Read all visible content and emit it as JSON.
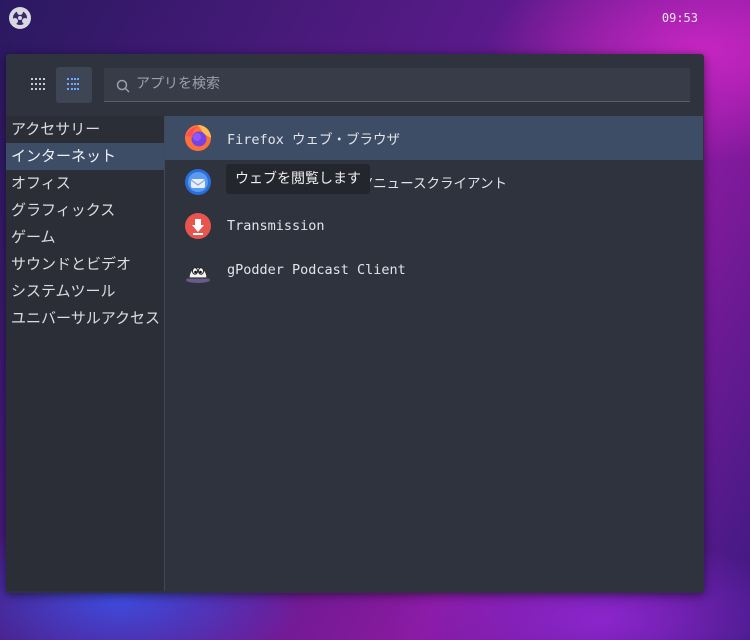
{
  "topbar": {
    "clock": "09:53",
    "distro_icon": "os-logo-icon"
  },
  "menu": {
    "view_buttons": {
      "grid": "grid-view-icon",
      "list": "list-view-icon"
    },
    "search": {
      "placeholder": "アプリを検索",
      "value": ""
    },
    "categories": [
      {
        "label": "アクセサリー",
        "selected": false
      },
      {
        "label": "インターネット",
        "selected": true
      },
      {
        "label": "オフィス",
        "selected": false
      },
      {
        "label": "グラフィックス",
        "selected": false
      },
      {
        "label": "ゲーム",
        "selected": false
      },
      {
        "label": "サウンドとビデオ",
        "selected": false
      },
      {
        "label": "システムツール",
        "selected": false
      },
      {
        "label": "ユニバーサルアクセス",
        "selected": false
      }
    ],
    "apps": [
      {
        "label": "Firefox ウェブ・ブラウザ",
        "icon": "firefox-icon",
        "selected": true
      },
      {
        "label": "Thunderbird メール/ニュースクライアント",
        "icon": "thunderbird-icon",
        "selected": false
      },
      {
        "label": "Transmission",
        "icon": "transmission-icon",
        "selected": false
      },
      {
        "label": "gPodder Podcast Client",
        "icon": "gpodder-icon",
        "selected": false
      }
    ],
    "tooltip": "ウェブを閲覧します"
  },
  "colors": {
    "accent": "#3e4d66",
    "panel": "#2f333d",
    "text": "#e2e4ea"
  }
}
